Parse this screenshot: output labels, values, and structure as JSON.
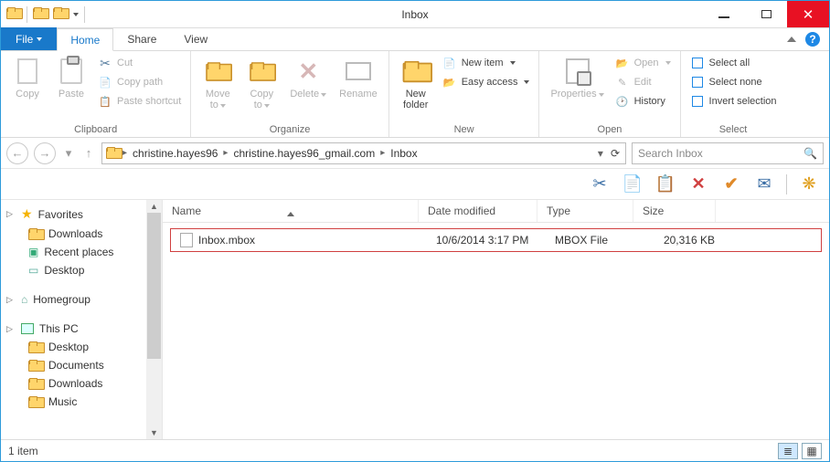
{
  "window": {
    "title": "Inbox"
  },
  "tabs": {
    "file": "File",
    "home": "Home",
    "share": "Share",
    "view": "View"
  },
  "ribbon": {
    "clipboard": {
      "label": "Clipboard",
      "copy": "Copy",
      "paste": "Paste",
      "cut": "Cut",
      "copy_path": "Copy path",
      "paste_shortcut": "Paste shortcut"
    },
    "organize": {
      "label": "Organize",
      "move_to": "Move\nto",
      "copy_to": "Copy\nto",
      "delete": "Delete",
      "rename": "Rename"
    },
    "new": {
      "label": "New",
      "new_folder": "New\nfolder",
      "new_item": "New item",
      "easy_access": "Easy access"
    },
    "open": {
      "label": "Open",
      "properties": "Properties",
      "open": "Open",
      "edit": "Edit",
      "history": "History"
    },
    "select": {
      "label": "Select",
      "select_all": "Select all",
      "select_none": "Select none",
      "invert": "Invert selection"
    }
  },
  "breadcrumb": {
    "seg1": "christine.hayes96",
    "seg2": "christine.hayes96_gmail.com",
    "seg3": "Inbox"
  },
  "search": {
    "placeholder": "Search Inbox"
  },
  "nav": {
    "favorites": "Favorites",
    "downloads": "Downloads",
    "recent": "Recent places",
    "desktop": "Desktop",
    "homegroup": "Homegroup",
    "thispc": "This PC",
    "pc_desktop": "Desktop",
    "pc_documents": "Documents",
    "pc_downloads": "Downloads",
    "pc_music": "Music"
  },
  "columns": {
    "name": "Name",
    "modified": "Date modified",
    "type": "Type",
    "size": "Size"
  },
  "files": [
    {
      "name": "Inbox.mbox",
      "modified": "10/6/2014 3:17 PM",
      "type": "MBOX File",
      "size": "20,316 KB"
    }
  ],
  "status": {
    "text": "1 item"
  }
}
